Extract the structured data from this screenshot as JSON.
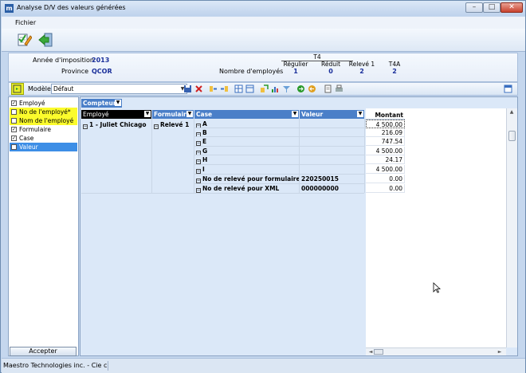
{
  "window": {
    "title": "Analyse D/V des valeurs générées",
    "app_icon_letter": "m",
    "minimize_glyph": "–",
    "maximize_glyph": "□",
    "close_glyph": "✕"
  },
  "menu": {
    "items": [
      {
        "label": "Fichier"
      }
    ]
  },
  "toolbar": {
    "icons": [
      "edit-document-icon",
      "exit-door-icon"
    ]
  },
  "header": {
    "annee_label": "Année d'imposition",
    "annee_value": "2013",
    "province_label": "Province",
    "province_value": "QCOR",
    "nb_employes_label": "Nombre d'employés",
    "t4_group": "T4",
    "columns": [
      {
        "label": "Régulier",
        "value": "1"
      },
      {
        "label": "Réduit",
        "value": "0"
      },
      {
        "label": "Relevé 1",
        "value": "2"
      },
      {
        "label": "T4A",
        "value": "2"
      }
    ]
  },
  "toolbar2": {
    "model_label": "Modèle",
    "model_value": "Défaut"
  },
  "fields": [
    {
      "label": "Employé",
      "checked": true,
      "highlight": "none"
    },
    {
      "label": "No de l'employé*",
      "checked": false,
      "highlight": "yellow"
    },
    {
      "label": "Nom de l'employé",
      "checked": false,
      "highlight": "yellow"
    },
    {
      "label": "Formulaire",
      "checked": true,
      "highlight": "none"
    },
    {
      "label": "Case",
      "checked": true,
      "highlight": "none"
    },
    {
      "label": "Valeur",
      "checked": true,
      "highlight": "selected"
    }
  ],
  "accept_label": "Accepter",
  "grid": {
    "compteur_label": "Compteur",
    "headers": {
      "employe": "Employé",
      "formulaire": "Formulaire",
      "case": "Case",
      "valeur": "Valeur",
      "montant": "Montant"
    },
    "employee": "1 - Juliet Chicago",
    "formulaire": "Relevé 1",
    "rows": [
      {
        "case": "A",
        "valeur": "",
        "montant": "4 500.00"
      },
      {
        "case": "B",
        "valeur": "",
        "montant": "216.09"
      },
      {
        "case": "E",
        "valeur": "",
        "montant": "747.54"
      },
      {
        "case": "G",
        "valeur": "",
        "montant": "4 500.00"
      },
      {
        "case": "H",
        "valeur": "",
        "montant": "24.17"
      },
      {
        "case": "I",
        "valeur": "",
        "montant": "4 500.00"
      },
      {
        "case": "No de relevé pour formulaires",
        "valeur": "220250015",
        "montant": "0.00"
      },
      {
        "case": "No de relevé pour XML",
        "valeur": "000000000",
        "montant": "0.00"
      }
    ]
  },
  "status": {
    "text": "Maestro Technologies inc. - Cie c"
  },
  "colors": {
    "accent": "#4a7fc8",
    "highlight": "#fbfb2c",
    "selected": "#3d8ee6"
  }
}
